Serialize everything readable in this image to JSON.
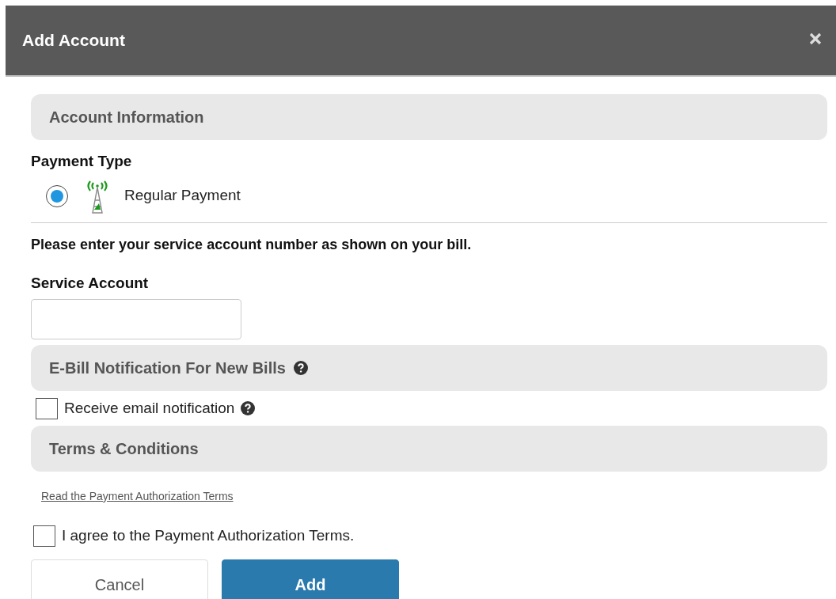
{
  "dialog": {
    "title": "Add Account"
  },
  "account_section": {
    "title": "Account Information"
  },
  "payment_type": {
    "label": "Payment Type",
    "options": [
      {
        "label": "Regular Payment",
        "selected": true
      }
    ]
  },
  "instruction": "Please enter your service account number as shown on your bill.",
  "service_account": {
    "label": "Service Account"
  },
  "ebill_section": {
    "title": "E-Bill Notification For New Bills"
  },
  "email_notification": {
    "label": "Receive email notification",
    "checked": false
  },
  "terms_section": {
    "title": "Terms & Conditions"
  },
  "terms_link": "Read the Payment Authorization Terms",
  "agree": {
    "label": "I agree to the Payment Authorization Terms.",
    "checked": false
  },
  "buttons": [
    {
      "label": "Cancel",
      "kind": "secondary"
    },
    {
      "label": "Add",
      "kind": "primary"
    }
  ]
}
